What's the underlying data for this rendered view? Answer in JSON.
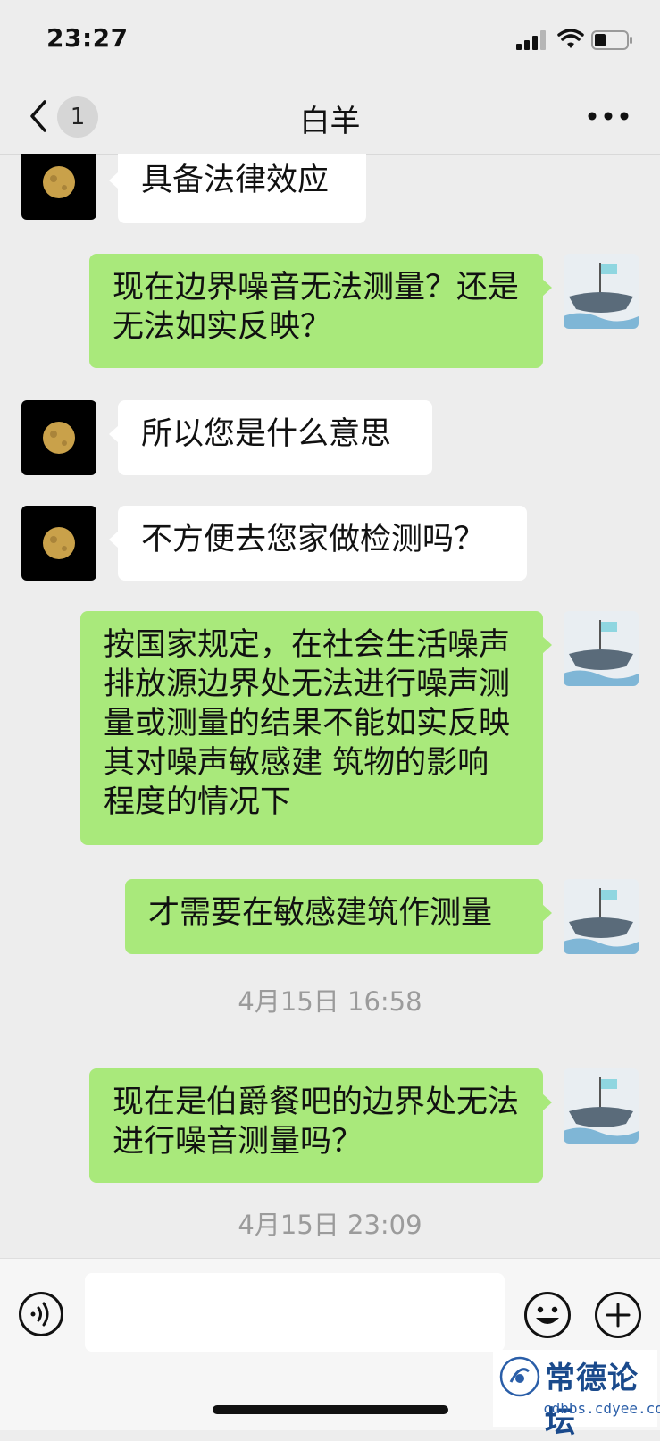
{
  "status_bar": {
    "time": "23:27"
  },
  "header": {
    "back_count": "1",
    "title": "白羊"
  },
  "messages": [
    {
      "side": "in",
      "text": "具备法律效应"
    },
    {
      "side": "out",
      "text": "现在边界噪音无法测量？还是无法如实反映？"
    },
    {
      "side": "in",
      "text": "所以您是什么意思"
    },
    {
      "side": "in",
      "text": "不方便去您家做检测吗？"
    },
    {
      "side": "out",
      "text": "按国家规定，在社会生活噪声排放源边界处无法进行噪声测量或测量的结果不能如实反映其对噪声敏感建 筑物的影响程度的情况下"
    },
    {
      "side": "out",
      "text": "才需要在敏感建筑作测量"
    },
    {
      "type": "time",
      "text": "4月15日 16:58"
    },
    {
      "side": "out",
      "text": "现在是伯爵餐吧的边界处无法进行噪音测量吗？"
    },
    {
      "type": "time",
      "text": "4月15日 23:09"
    }
  ],
  "input": {
    "value": "",
    "placeholder": ""
  },
  "watermark": {
    "title": "常德论坛",
    "url": "cdbbs.cdyee.com"
  },
  "colors": {
    "background": "#ededed",
    "outgoing_bubble": "#a9e97b",
    "incoming_bubble": "#ffffff"
  },
  "icons": [
    "back-chevron-icon",
    "more-dots-icon",
    "voice-icon",
    "emoji-icon",
    "plus-icon",
    "signal-icon",
    "wifi-icon",
    "battery-icon"
  ]
}
